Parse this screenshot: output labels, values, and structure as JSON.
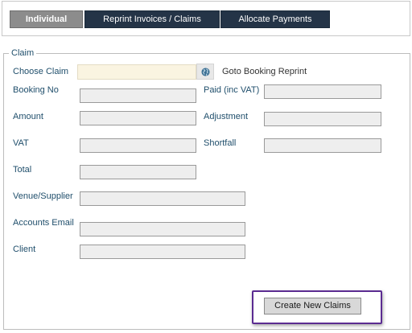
{
  "tabs": [
    {
      "label": "Individual"
    },
    {
      "label": "Reprint Invoices / Claims"
    },
    {
      "label": "Allocate Payments"
    }
  ],
  "claim": {
    "legend": "Claim",
    "choose_claim_label": "Choose Claim",
    "choose_claim_value": "",
    "goto_booking_label": "Goto Booking Reprint",
    "globe_icon": "globe-icon",
    "fields": {
      "booking_no": {
        "label": "Booking No",
        "value": ""
      },
      "paid": {
        "label": "Paid (inc VAT)",
        "value": ""
      },
      "amount": {
        "label": "Amount",
        "value": ""
      },
      "adjustment": {
        "label": "Adjustment",
        "value": ""
      },
      "vat": {
        "label": "VAT",
        "value": ""
      },
      "shortfall": {
        "label": "Shortfall",
        "value": ""
      },
      "total": {
        "label": "Total",
        "value": ""
      },
      "venue_supplier": {
        "label": "Venue/Supplier",
        "value": ""
      },
      "accounts_email": {
        "label": "Accounts Email",
        "value": ""
      },
      "client": {
        "label": "Client",
        "value": ""
      }
    },
    "create_button": "Create New Claims"
  },
  "colors": {
    "tab_dark": "#243447",
    "tab_active": "#8c8c8c",
    "label_text": "#1f4e6b",
    "input_bg": "#eeeeee",
    "choose_claim_bg": "#faf4e1",
    "highlight_border": "#5b2c91"
  }
}
